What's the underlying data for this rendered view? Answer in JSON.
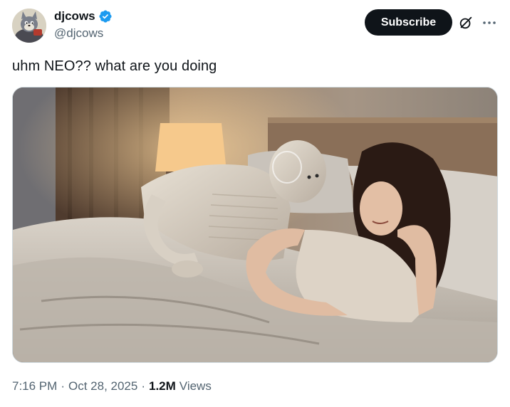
{
  "author": {
    "display_name": "djcows",
    "handle": "@djcows",
    "verified": true,
    "verified_color": "#1d9bf0",
    "avatar_icon": "cartoon-cat-avatar"
  },
  "actions": {
    "subscribe_label": "Subscribe",
    "grok_icon": "slashed-circle-icon",
    "more_icon": "ellipsis-icon"
  },
  "post": {
    "text": "uhm NEO?? what are you doing",
    "media_description": "photo"
  },
  "meta": {
    "time": "7:16 PM",
    "separator": "·",
    "date": "Oct 28, 2025",
    "views_count": "1.2M",
    "views_label": "Views"
  },
  "colors": {
    "text_primary": "#0f1419",
    "text_secondary": "#536471",
    "button_bg": "#0f1419"
  }
}
